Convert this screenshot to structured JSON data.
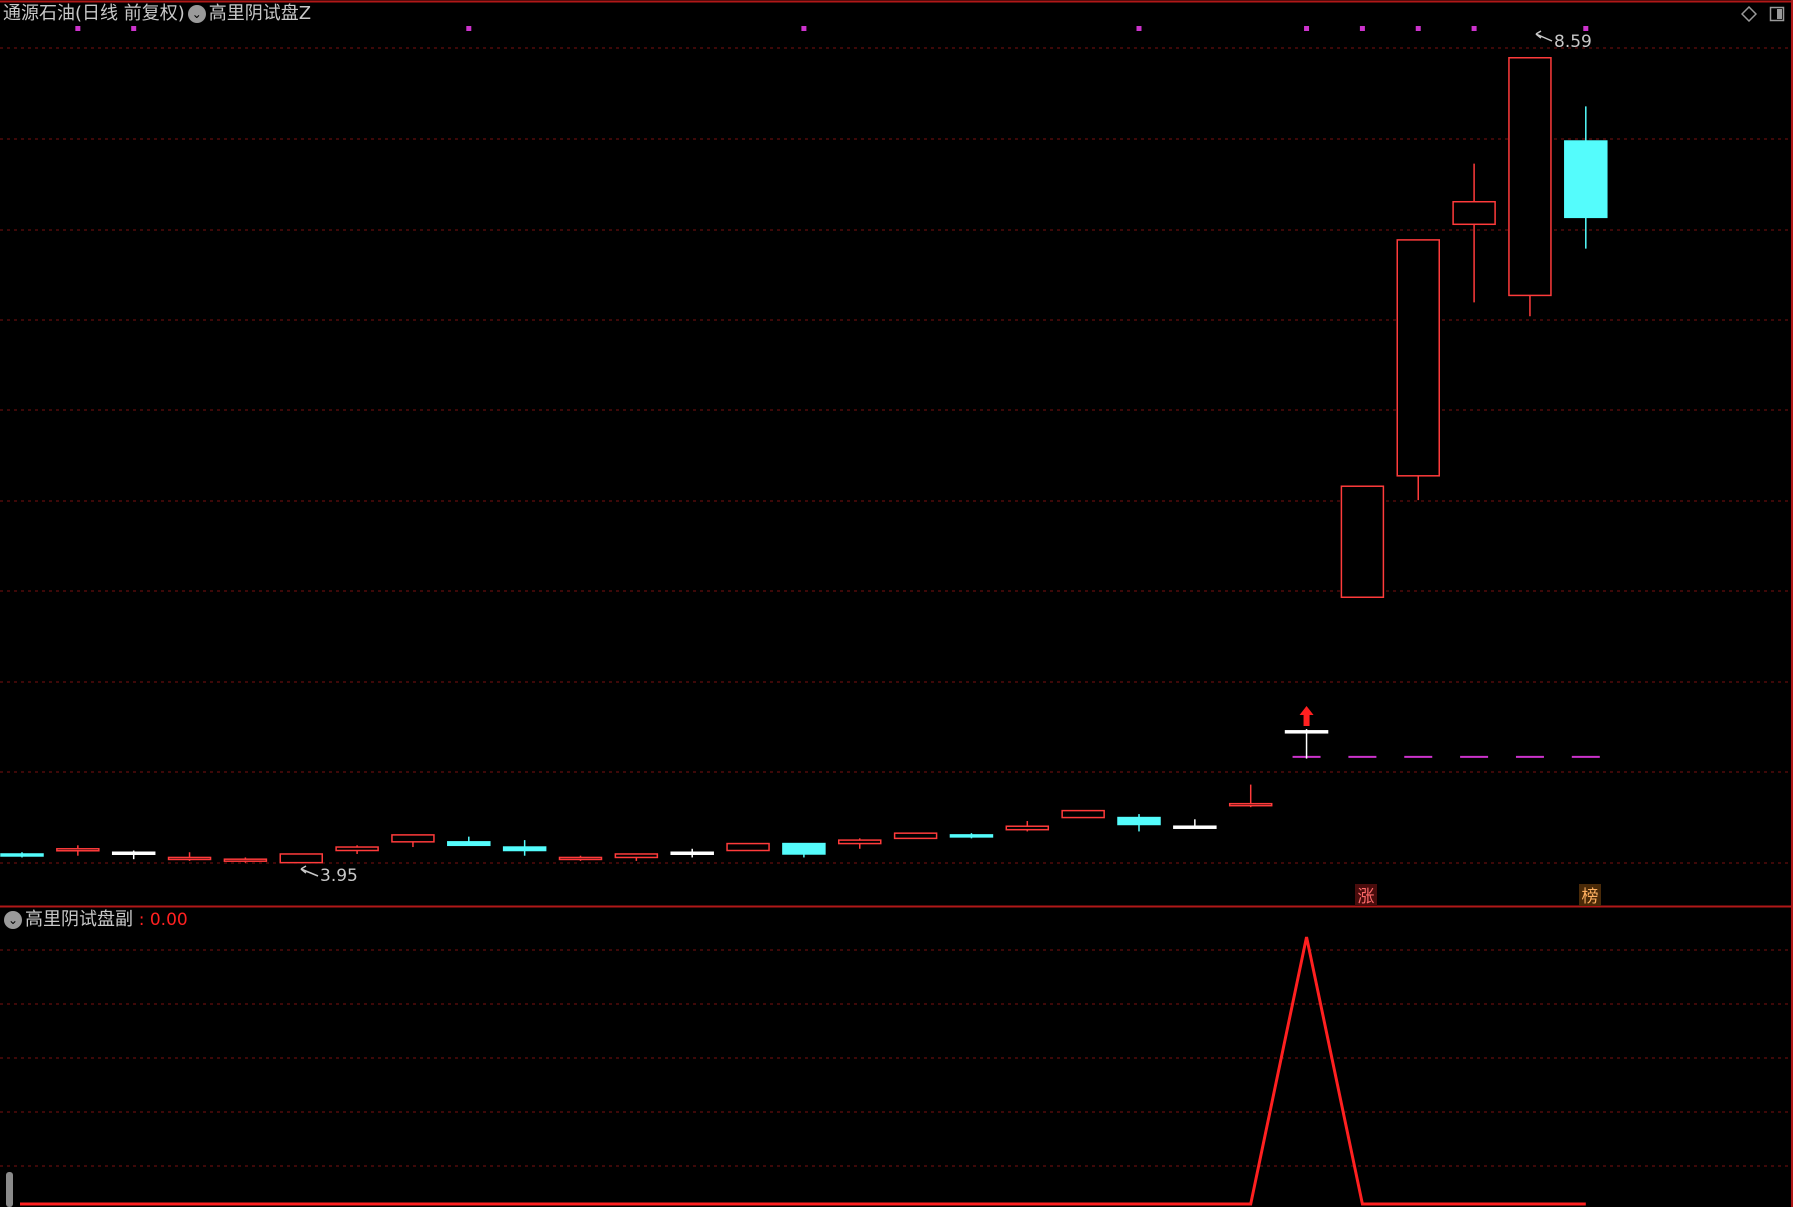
{
  "header": {
    "security_name": "通源石油(日线 前复权)",
    "main_indicator": "高里阴试盘Z",
    "sub_indicator": "高里阴试盘副",
    "sub_indicator_value": ": 0.00"
  },
  "colors": {
    "background": "#000000",
    "up": "#ff3b3b",
    "down": "#54fcfc",
    "flat": "#ffffff",
    "grid": "#7a1010",
    "marker": "#cc33cc",
    "arrow": "#ff2020",
    "indicator_line": "#ff2020"
  },
  "icons": [
    "chevron-down-icon",
    "diamond-icon",
    "restore-window-icon",
    "arrow-up-icon",
    "scrollbar-handle"
  ],
  "chart_data": [
    {
      "type": "candlestick",
      "candles": [
        {
          "o": 4.0,
          "h": 4.01,
          "l": 3.98,
          "c": 3.99
        },
        {
          "o": 4.02,
          "h": 4.05,
          "l": 3.99,
          "c": 4.03
        },
        {
          "o": 4.01,
          "h": 4.02,
          "l": 3.97,
          "c": 4.01
        },
        {
          "o": 3.97,
          "h": 4.01,
          "l": 3.96,
          "c": 3.98
        },
        {
          "o": 3.96,
          "h": 3.98,
          "l": 3.95,
          "c": 3.97
        },
        {
          "o": 3.95,
          "h": 4.0,
          "l": 3.95,
          "c": 4.0
        },
        {
          "o": 4.02,
          "h": 4.05,
          "l": 4.0,
          "c": 4.04
        },
        {
          "o": 4.07,
          "h": 4.11,
          "l": 4.04,
          "c": 4.11
        },
        {
          "o": 4.07,
          "h": 4.1,
          "l": 4.05,
          "c": 4.05
        },
        {
          "o": 4.04,
          "h": 4.08,
          "l": 3.99,
          "c": 4.02
        },
        {
          "o": 3.97,
          "h": 3.99,
          "l": 3.96,
          "c": 3.98
        },
        {
          "o": 3.98,
          "h": 4.0,
          "l": 3.96,
          "c": 4.0
        },
        {
          "o": 4.01,
          "h": 4.03,
          "l": 3.98,
          "c": 4.01
        },
        {
          "o": 4.02,
          "h": 4.06,
          "l": 4.02,
          "c": 4.06
        },
        {
          "o": 4.06,
          "h": 4.06,
          "l": 3.98,
          "c": 4.0
        },
        {
          "o": 4.06,
          "h": 4.09,
          "l": 4.03,
          "c": 4.08
        },
        {
          "o": 4.09,
          "h": 4.12,
          "l": 4.09,
          "c": 4.12
        },
        {
          "o": 4.11,
          "h": 4.12,
          "l": 4.09,
          "c": 4.1
        },
        {
          "o": 4.14,
          "h": 4.19,
          "l": 4.13,
          "c": 4.16
        },
        {
          "o": 4.21,
          "h": 4.25,
          "l": 4.21,
          "c": 4.25
        },
        {
          "o": 4.21,
          "h": 4.23,
          "l": 4.13,
          "c": 4.17
        },
        {
          "o": 4.16,
          "h": 4.2,
          "l": 4.16,
          "c": 4.16
        },
        {
          "o": 4.28,
          "h": 4.4,
          "l": 4.27,
          "c": 4.29
        },
        {
          "o": 4.71,
          "h": 4.72,
          "l": 4.55,
          "c": 4.71
        },
        {
          "o": 5.48,
          "h": 5.66,
          "l": 5.48,
          "c": 6.12
        },
        {
          "o": 6.18,
          "h": 7.13,
          "l": 6.04,
          "c": 7.54
        },
        {
          "o": 7.63,
          "h": 7.98,
          "l": 7.18,
          "c": 7.76
        },
        {
          "o": 7.22,
          "h": 8.59,
          "l": 7.1,
          "c": 8.59
        },
        {
          "o": 8.11,
          "h": 8.31,
          "l": 7.49,
          "c": 7.67
        }
      ],
      "ylim": [
        3.85,
        8.75
      ],
      "annotations": {
        "high_label": "8.59",
        "low_label": "3.95",
        "badge_1": "涨",
        "badge_2": "榜"
      },
      "signal_arrow_index": 23,
      "marker_dot_indices": [
        1,
        2,
        8,
        14,
        20,
        23,
        24,
        25,
        26,
        28
      ],
      "dash_level": 4.56,
      "dash_indices": [
        23,
        24,
        25,
        26,
        27,
        28
      ]
    },
    {
      "type": "line",
      "series": [
        {
          "values": [
            0,
            0,
            0,
            0,
            0,
            0,
            0,
            0,
            0,
            0,
            0,
            0,
            0,
            0,
            0,
            0,
            0,
            0,
            0,
            0,
            0,
            0,
            0,
            1,
            0,
            0,
            0,
            0,
            0
          ]
        }
      ],
      "ylim": [
        0,
        1
      ]
    }
  ]
}
